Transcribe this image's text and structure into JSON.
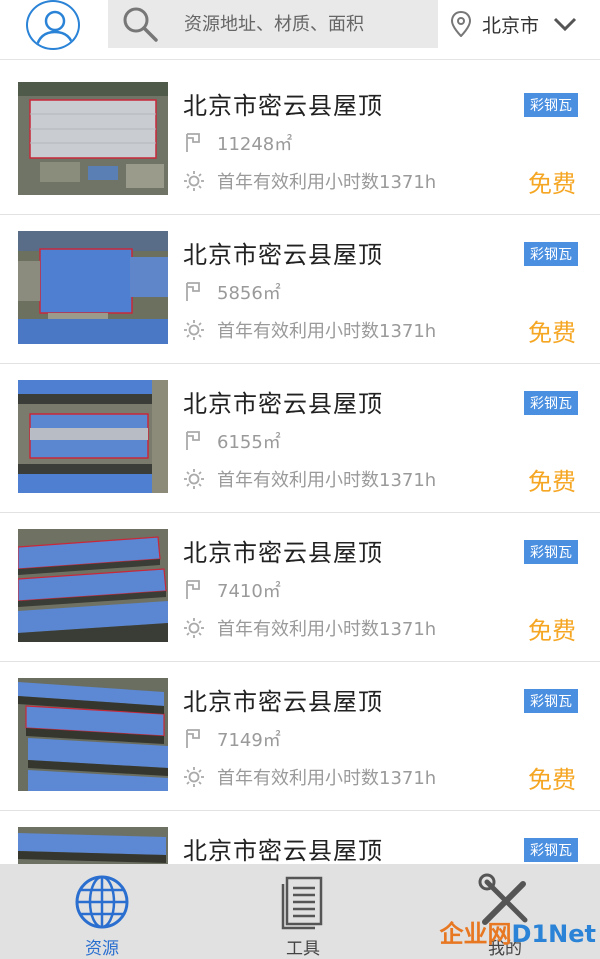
{
  "header": {
    "search_placeholder": "资源地址、材质、面积",
    "city": "北京市"
  },
  "items": [
    {
      "title": "北京市密云县屋顶",
      "badge": "彩钢瓦",
      "area": "11248㎡",
      "hours": "首年有效利用小时数1371h",
      "price": "免费"
    },
    {
      "title": "北京市密云县屋顶",
      "badge": "彩钢瓦",
      "area": "5856㎡",
      "hours": "首年有效利用小时数1371h",
      "price": "免费"
    },
    {
      "title": "北京市密云县屋顶",
      "badge": "彩钢瓦",
      "area": "6155㎡",
      "hours": "首年有效利用小时数1371h",
      "price": "免费"
    },
    {
      "title": "北京市密云县屋顶",
      "badge": "彩钢瓦",
      "area": "7410㎡",
      "hours": "首年有效利用小时数1371h",
      "price": "免费"
    },
    {
      "title": "北京市密云县屋顶",
      "badge": "彩钢瓦",
      "area": "7149㎡",
      "hours": "首年有效利用小时数1371h",
      "price": "免费"
    },
    {
      "title": "北京市密云县屋顶",
      "badge": "彩钢瓦"
    }
  ],
  "nav": {
    "resources": "资源",
    "tools": "工具",
    "third": "我的"
  },
  "watermark": {
    "brand_a": "企业网",
    "brand_b": "D1Net"
  },
  "colors": {
    "accent": "#2a83d6",
    "badge": "#4b8fe0",
    "price": "#f5a623"
  }
}
